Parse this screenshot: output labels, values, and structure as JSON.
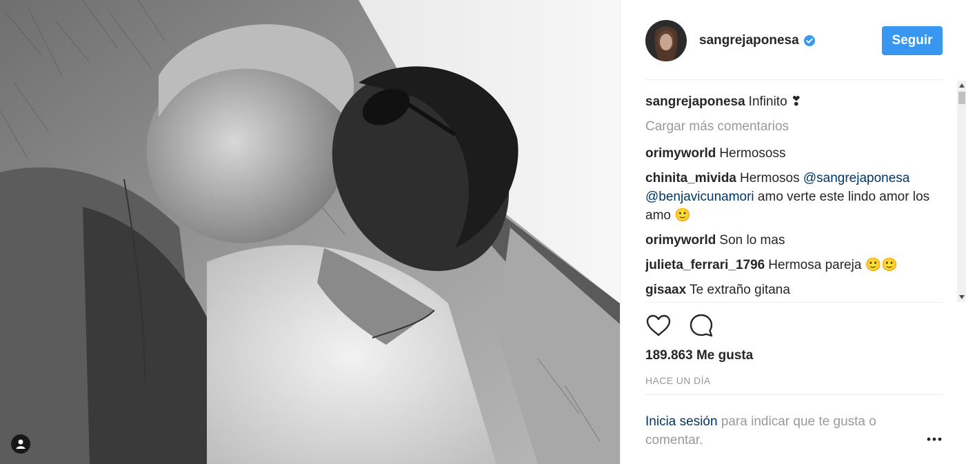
{
  "post": {
    "username": "sangrejaponesa",
    "verified": true,
    "follow_label": "Seguir",
    "caption_user": "sangrejaponesa",
    "caption_text": "Infinito ❣",
    "load_more_label": "Cargar más comentarios",
    "comments": [
      {
        "user": "orimyworld",
        "text": "Hermososs"
      },
      {
        "user": "chinita_mivida",
        "text_before": "Hermosos ",
        "mention1": "@sangrejaponesa",
        "text_mid": " ",
        "mention2": "@benjavicunamori",
        "text_after": " amo verte este lindo amor los amo 🙂"
      },
      {
        "user": "orimyworld",
        "text": "Son lo mas"
      },
      {
        "user": "julieta_ferrari_1796",
        "text": "Hermosa pareja 🙂🙂"
      },
      {
        "user": "gisaax",
        "text": "Te extraño gitana"
      }
    ],
    "likes": "189.863 Me gusta",
    "time": "HACE UN DÍA",
    "login_link": "Inicia sesión",
    "login_text": " para indicar que te gusta o comentar."
  },
  "colors": {
    "accent": "#3897f0",
    "link": "#003569",
    "muted": "#999999",
    "text": "#262626"
  },
  "icons": {
    "verified": "verified-badge-icon",
    "like": "heart-icon",
    "comment": "comment-bubble-icon",
    "more": "more-options-icon",
    "tag": "user-tag-icon"
  }
}
